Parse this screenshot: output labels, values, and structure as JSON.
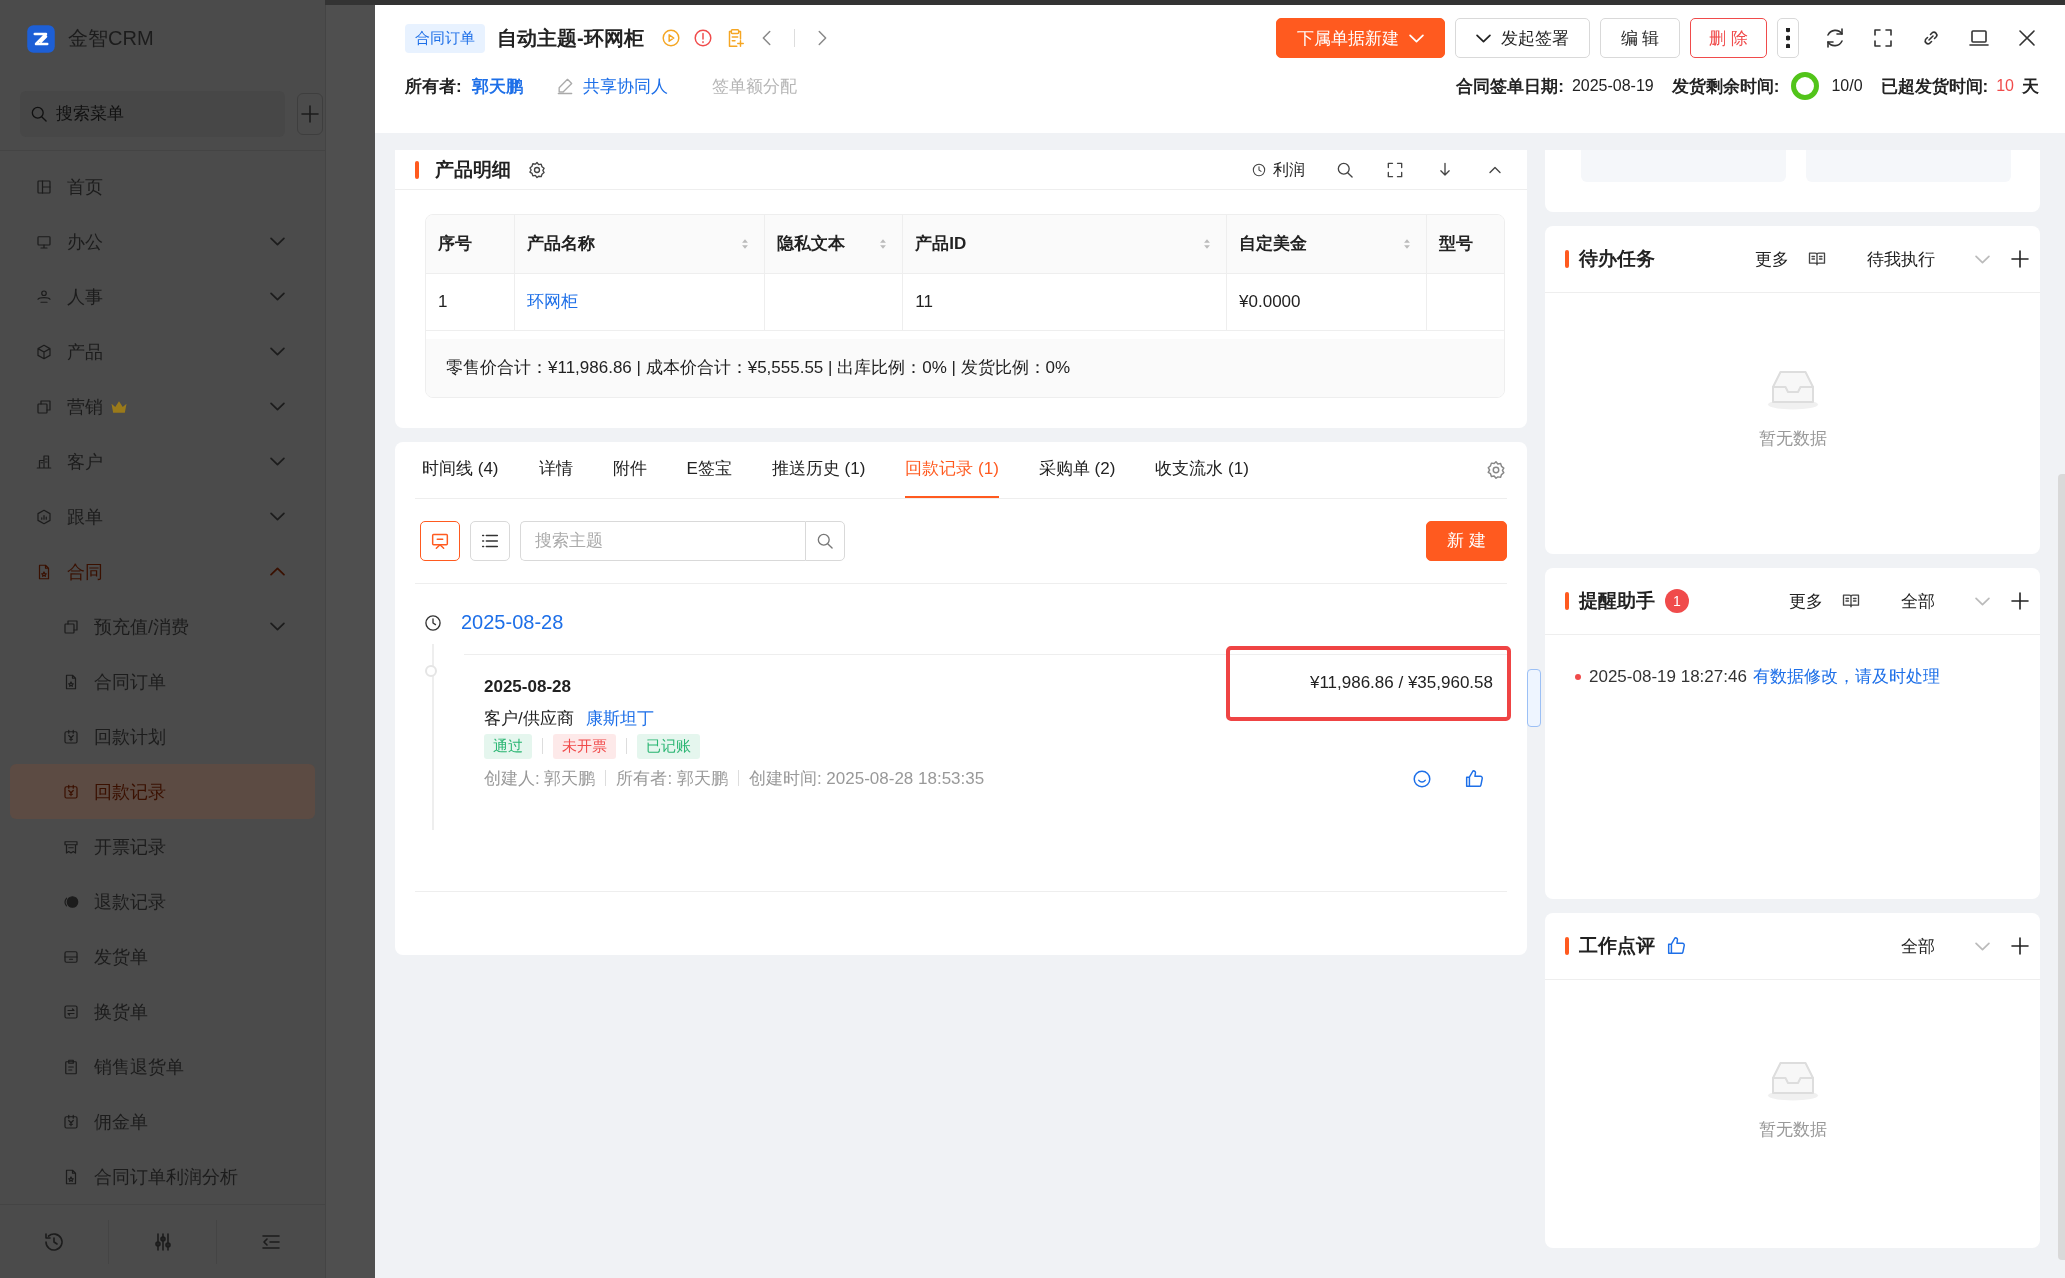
{
  "sidebar": {
    "logo": "金智CRM",
    "search": {
      "placeholder": "搜索菜单"
    },
    "items": [
      {
        "label": "首页",
        "selected": false
      },
      {
        "label": "办公",
        "selected": false,
        "expanded": false
      },
      {
        "label": "人事",
        "selected": false,
        "expanded": false
      },
      {
        "label": "产品",
        "selected": false,
        "expanded": false
      },
      {
        "label": "营销",
        "selected": false,
        "expanded": false,
        "premium": true
      },
      {
        "label": "客户",
        "selected": false,
        "expanded": false
      },
      {
        "label": "跟单",
        "selected": false,
        "expanded": false
      },
      {
        "label": "合同",
        "selected": true,
        "expanded": true,
        "children": [
          {
            "label": "预充值/消费",
            "selected": false,
            "expanded": false
          },
          {
            "label": "合同订单",
            "selected": false
          },
          {
            "label": "回款计划",
            "selected": false
          },
          {
            "label": "回款记录",
            "selected": true
          },
          {
            "label": "开票记录",
            "selected": false
          },
          {
            "label": "退款记录",
            "selected": false
          },
          {
            "label": "发货单",
            "selected": false
          },
          {
            "label": "换货单",
            "selected": false
          },
          {
            "label": "销售退货单",
            "selected": false
          },
          {
            "label": "佣金单",
            "selected": false
          },
          {
            "label": "合同订单利润分析",
            "selected": false
          }
        ]
      }
    ]
  },
  "drawer": {
    "tag": "合同订单",
    "title": "自动主题-环网柜",
    "owner_label": "所有者:",
    "owner": "郭天鹏",
    "share": "共享协同人",
    "allocate": "签单额分配",
    "actions": [
      {
        "label": "下属单据新建",
        "kind": "primary"
      },
      {
        "label": "发起签署",
        "kind": "dropdown"
      },
      {
        "label": "编 辑",
        "kind": "default"
      },
      {
        "label": "删 除",
        "kind": "danger"
      }
    ],
    "meta": {
      "sign_date_label": "合同签单日期:",
      "sign_date": "2025-08-19",
      "remaining_label": "发货剩余时间:",
      "remaining": "10/0",
      "overdue_label": "已超发货时间:",
      "overdue": "10",
      "overdue_unit": "天"
    }
  },
  "products": {
    "title": "产品明细",
    "profit": "利润",
    "columns": [
      {
        "label": "序号",
        "sortable": false
      },
      {
        "label": "产品名称",
        "sortable": true
      },
      {
        "label": "隐私文本",
        "sortable": true
      },
      {
        "label": "产品ID",
        "sortable": true
      },
      {
        "label": "自定美金",
        "sortable": true
      },
      {
        "label": "型号",
        "sortable": false
      }
    ],
    "rows": [
      {
        "index": "1",
        "name": "环网柜",
        "product_id": "11",
        "amount": "¥0.0000"
      }
    ],
    "summary": "零售价合计：¥11,986.86 | 成本价合计：¥5,555.55 | 出库比例：0% | 发货比例：0%"
  },
  "tabs": [
    {
      "label": "时间线 (4)",
      "selected": false
    },
    {
      "label": "详情",
      "selected": false
    },
    {
      "label": "附件",
      "selected": false
    },
    {
      "label": "E签宝",
      "selected": false
    },
    {
      "label": "推送历史 (1)",
      "selected": false
    },
    {
      "label": "回款记录 (1)",
      "selected": true
    },
    {
      "label": "采购单 (2)",
      "selected": false
    },
    {
      "label": "收支流水 (1)",
      "selected": false
    }
  ],
  "records": {
    "views": [
      {
        "selected": true
      },
      {
        "selected": false
      }
    ],
    "search": {
      "placeholder": "搜索主题"
    },
    "new_button": "新 建",
    "groups": [
      {
        "date": "2025-08-28",
        "entries": [
          {
            "date": "2025-08-28",
            "party_label": "客户/供应商",
            "party": "康斯坦丁",
            "tags": [
              {
                "label": "通过",
                "color": "#2bb673"
              },
              {
                "label": "未开票",
                "color": "#f04b4b"
              },
              {
                "label": "已记账",
                "color": "#2bb673"
              }
            ],
            "meta": [
              "创建人: 郭天鹏",
              "所有者: 郭天鹏",
              "创建时间: 2025-08-28 18:53:35"
            ],
            "amount": "¥11,986.86 / ¥35,960.58",
            "highlighted": true
          }
        ]
      }
    ]
  },
  "tasks": {
    "title": "待办任务",
    "more": "更多",
    "filter": "待我执行",
    "empty": "暂无数据"
  },
  "reminders": {
    "title": "提醒助手",
    "badge": "1",
    "more": "更多",
    "filter": "全部",
    "items": [
      {
        "time": "2025-08-19 18:27:46",
        "text": "有数据修改，请及时处理"
      }
    ]
  },
  "reviews": {
    "title": "工作点评",
    "filter": "全部",
    "empty": "暂无数据"
  }
}
